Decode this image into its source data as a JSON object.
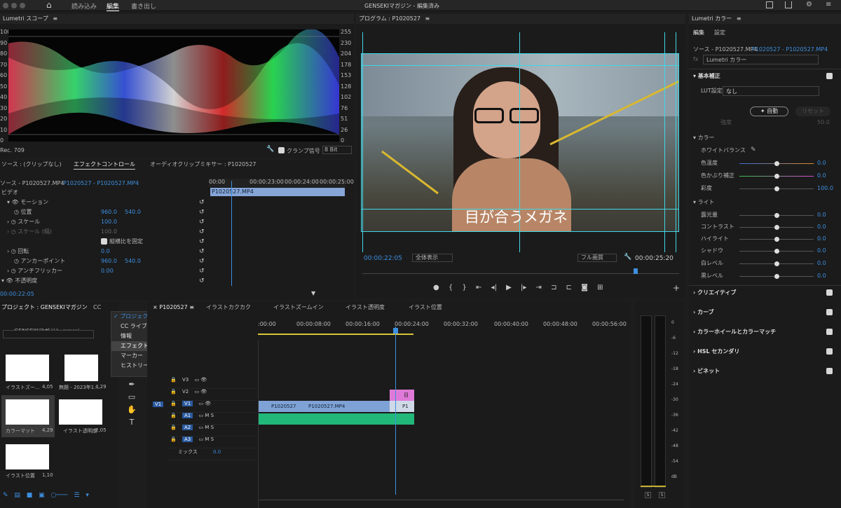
{
  "topbar": {
    "home": "⌂",
    "tab_import": "読み込み",
    "tab_edit": "編集",
    "tab_export": "書き出し",
    "title": "GENSEKIマガジン - 編集済み"
  },
  "scope": {
    "title": "Lumetri スコープ",
    "left_ticks": [
      "100",
      "90",
      "80",
      "70",
      "60",
      "50",
      "40",
      "30",
      "20",
      "10",
      "0"
    ],
    "right_ticks": [
      "255",
      "230",
      "204",
      "178",
      "153",
      "128",
      "102",
      "76",
      "51",
      "26",
      "0"
    ],
    "rec": "Rec. 709",
    "clamp": "クランプ信号",
    "bits": "8 Bit"
  },
  "effects": {
    "tab_source": "ソース : (クリップなし)",
    "tab_effects": "エフェクトコントロール",
    "tab_mixer": "オーディオクリップミキサー : P1020527",
    "source_label": "ソース - P1020527.MP4",
    "seq_label": "P1020527 - P1020527.MP4",
    "times": [
      "00:00",
      "00:00:23:00",
      "00:00:24:00",
      "00:00:25:00"
    ],
    "clip": "P1020527.MP4",
    "video": "ビデオ",
    "motion": "モーション",
    "position": "位置",
    "pos_x": "960.0",
    "pos_y": "540.0",
    "scale": "スケール",
    "scale_val": "100.0",
    "scale_w": "スケール (幅)",
    "scale_w_val": "100.0",
    "uniform": "縦横比を固定",
    "rotation": "回転",
    "rot_val": "0.0",
    "anchor": "アンカーポイント",
    "anc_x": "960.0",
    "anc_y": "540.0",
    "flicker": "アンチフリッカー",
    "flicker_val": "0.00",
    "opacity": "不透明度",
    "timecode": "00:00:22:05"
  },
  "program": {
    "title": "プログラム : P1020527",
    "subtitle": "目が合うメガネ",
    "tc_left": "00:00:22:05",
    "fit": "全体表示",
    "quality": "フル画質",
    "tc_right": "00:00:25:20"
  },
  "lumetri": {
    "title": "Lumetri カラー",
    "tab_edit": "編集",
    "tab_settings": "設定",
    "source": "ソース - P1020527.MP4",
    "seq": "P1020527 - P1020527.MP4",
    "fx": "fx",
    "effect": "Lumetri カラー",
    "basic": "基本補正",
    "lut_label": "LUT設定",
    "lut_val": "なし",
    "intensity": "強度",
    "intensity_val": "50.0",
    "auto": "自動",
    "reset": "リセット",
    "color": "カラー",
    "wb": "ホワイトバランス",
    "temp": "色温度",
    "temp_val": "0.0",
    "tint": "色かぶり補正",
    "tint_val": "0.0",
    "sat": "彩度",
    "sat_val": "100.0",
    "light": "ライト",
    "exposure": "露光量",
    "exposure_val": "0.0",
    "contrast": "コントラスト",
    "contrast_val": "0.0",
    "highlight": "ハイライト",
    "highlight_val": "0.0",
    "shadow": "シャドウ",
    "shadow_val": "0.0",
    "white": "白レベル",
    "white_val": "0.0",
    "black": "黒レベル",
    "black_val": "0.0",
    "creative": "クリエイティブ",
    "curves": "カーブ",
    "wheels": "カラーホイールとカラーマッチ",
    "hsl": "HSL セカンダリ",
    "vignette": "ビネット"
  },
  "project": {
    "title": "プロジェクト : GENSEKIマガジン",
    "tab_cc": "CC",
    "file": "GENSEKIマガジン.prproj",
    "items": [
      {
        "name": "イラストズー...",
        "dur": "4,05"
      },
      {
        "name": "無題 - 2023年1...",
        "dur": "4,29"
      },
      {
        "name": "カラーマット",
        "dur": "4,29"
      },
      {
        "name": "イラスト透明度",
        "dur": "2,05"
      },
      {
        "name": "イラスト位置",
        "dur": "1,10"
      }
    ]
  },
  "menu": {
    "items": [
      "プロジェクト : GENSEKIマガジン",
      "CC ライブラリ",
      "情報",
      "エフェクト",
      "マーカー",
      "ヒストリー"
    ]
  },
  "timeline": {
    "tab_seq": "P1020527",
    "tabs": [
      "イラストカクカク",
      "イラストズームイン",
      "イラスト透明度",
      "イラスト位置"
    ],
    "ruler": [
      ":00:00",
      "00:00:08:00",
      "00:00:16:00",
      "00:00:24:00",
      "00:00:32:00",
      "00:00:40:00",
      "00:00:48:00",
      "00:00:56:00"
    ],
    "tracks": {
      "v3": "V3",
      "v2": "V2",
      "v1": "V1",
      "v1src": "V1",
      "a1": "A1",
      "a2": "A2",
      "a3": "A3",
      "mix": "ミックス",
      "mix_val": "0.0",
      "m": "M",
      "s": "S"
    },
    "clip1": "P1020527",
    "clip2": "P1020527.MP4",
    "clip3": "P1",
    "gfx": "目"
  },
  "meter": {
    "ticks": [
      "0",
      "-6",
      "-12",
      "-18",
      "-24",
      "-30",
      "-36",
      "-42",
      "-48",
      "-54",
      "dB"
    ],
    "s": "S"
  }
}
